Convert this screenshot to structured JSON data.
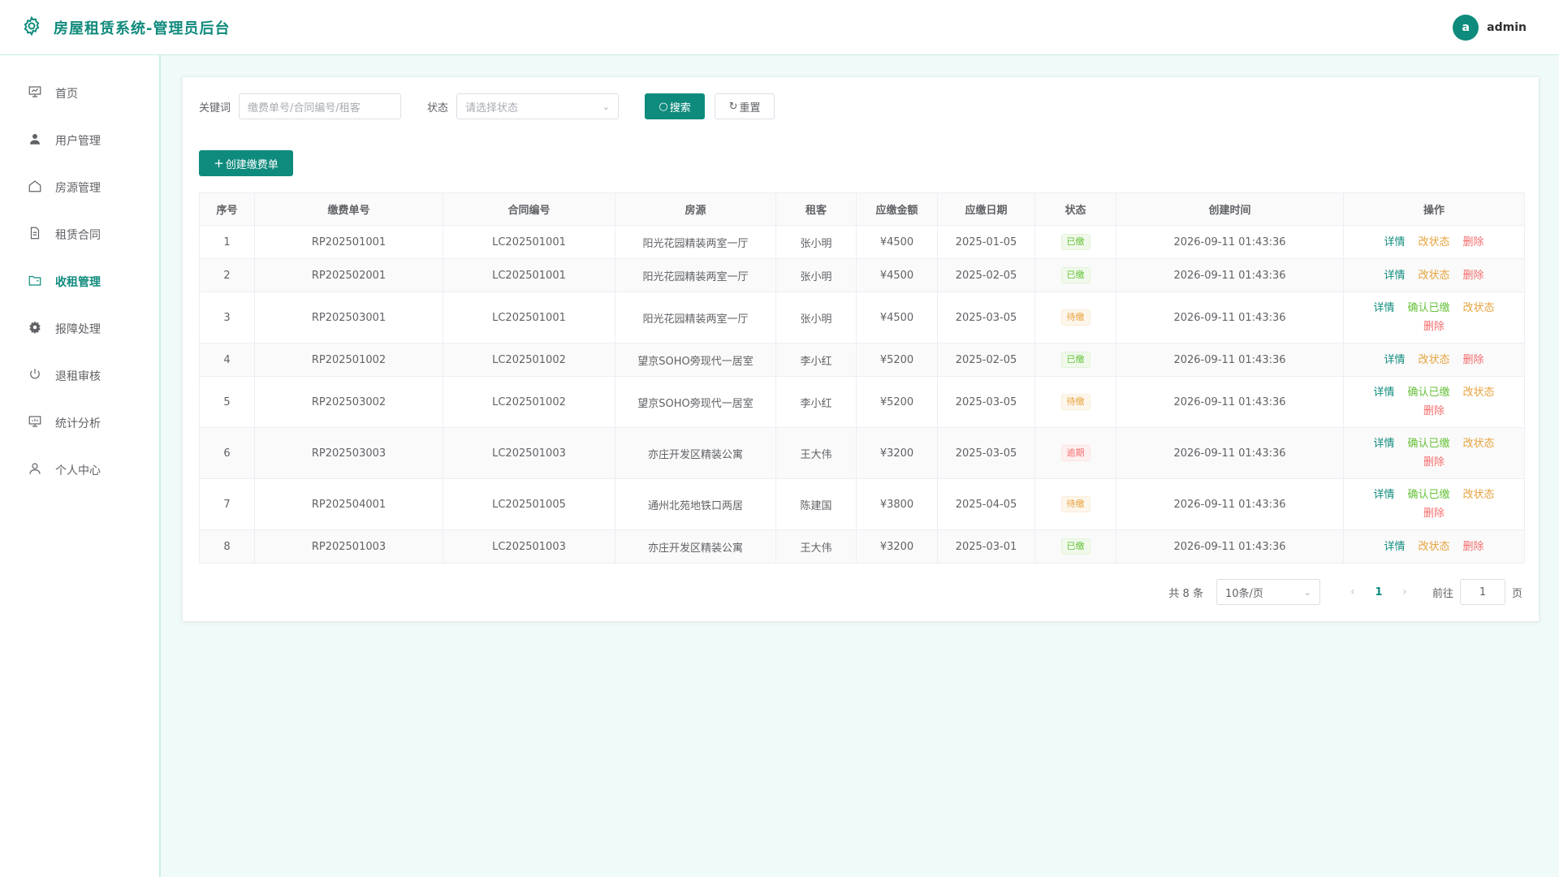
{
  "header": {
    "title": "房屋租赁系统-管理员后台",
    "avatar_letter": "a",
    "username": "admin"
  },
  "sidebar": {
    "items": [
      {
        "label": "首页",
        "icon": "presentation-icon"
      },
      {
        "label": "用户管理",
        "icon": "user-icon"
      },
      {
        "label": "房源管理",
        "icon": "house-icon"
      },
      {
        "label": "租赁合同",
        "icon": "document-icon"
      },
      {
        "label": "收租管理",
        "icon": "folder-icon",
        "active": true
      },
      {
        "label": "报障处理",
        "icon": "gear-icon"
      },
      {
        "label": "退租审核",
        "icon": "power-icon"
      },
      {
        "label": "统计分析",
        "icon": "chart-board-icon"
      },
      {
        "label": "个人中心",
        "icon": "user-outline-icon"
      }
    ]
  },
  "filters": {
    "keyword_label": "关键词",
    "keyword_placeholder": "缴费单号/合同编号/租客",
    "status_label": "状态",
    "status_placeholder": "请选择状态",
    "search_label": "搜索",
    "reset_label": "重置"
  },
  "create_label": "创建缴费单",
  "table": {
    "columns": [
      "序号",
      "缴费单号",
      "合同编号",
      "房源",
      "租客",
      "应缴金额",
      "应缴日期",
      "状态",
      "创建时间",
      "操作"
    ],
    "rows": [
      [
        "1",
        "RP202501001",
        "LC202501001",
        "阳光花园精装两室一厅",
        "张小明",
        "¥4500",
        "2025-01-05",
        "已缴",
        "2026-09-11 01:43:36"
      ],
      [
        "2",
        "RP202502001",
        "LC202501001",
        "阳光花园精装两室一厅",
        "张小明",
        "¥4500",
        "2025-02-05",
        "已缴",
        "2026-09-11 01:43:36"
      ],
      [
        "3",
        "RP202503001",
        "LC202501001",
        "阳光花园精装两室一厅",
        "张小明",
        "¥4500",
        "2025-03-05",
        "待缴",
        "2026-09-11 01:43:36"
      ],
      [
        "4",
        "RP202501002",
        "LC202501002",
        "望京SOHO旁现代一居室",
        "李小红",
        "¥5200",
        "2025-02-05",
        "已缴",
        "2026-09-11 01:43:36"
      ],
      [
        "5",
        "RP202503002",
        "LC202501002",
        "望京SOHO旁现代一居室",
        "李小红",
        "¥5200",
        "2025-03-05",
        "待缴",
        "2026-09-11 01:43:36"
      ],
      [
        "6",
        "RP202503003",
        "LC202501003",
        "亦庄开发区精装公寓",
        "王大伟",
        "¥3200",
        "2025-03-05",
        "逾期",
        "2026-09-11 01:43:36"
      ],
      [
        "7",
        "RP202504001",
        "LC202501005",
        "通州北苑地铁口两居",
        "陈建国",
        "¥3800",
        "2025-04-05",
        "待缴",
        "2026-09-11 01:43:36"
      ],
      [
        "8",
        "RP202501003",
        "LC202501003",
        "亦庄开发区精装公寓",
        "王大伟",
        "¥3200",
        "2025-03-01",
        "已缴",
        "2026-09-11 01:43:36"
      ]
    ],
    "ops": {
      "detail": "详情",
      "confirm": "确认已缴",
      "change_status": "改状态",
      "delete": "删除"
    }
  },
  "pagination": {
    "total_text": "共 8 条",
    "page_size": "10条/页",
    "prev": "‹",
    "current_page": "1",
    "next": "›",
    "goto_label": "前往",
    "goto_value": "1",
    "page_suffix": "页"
  },
  "colors": {
    "primary": "#0f8b7d",
    "paid": "#67c23a",
    "pending": "#e6a23c",
    "overdue": "#f56c6c"
  }
}
